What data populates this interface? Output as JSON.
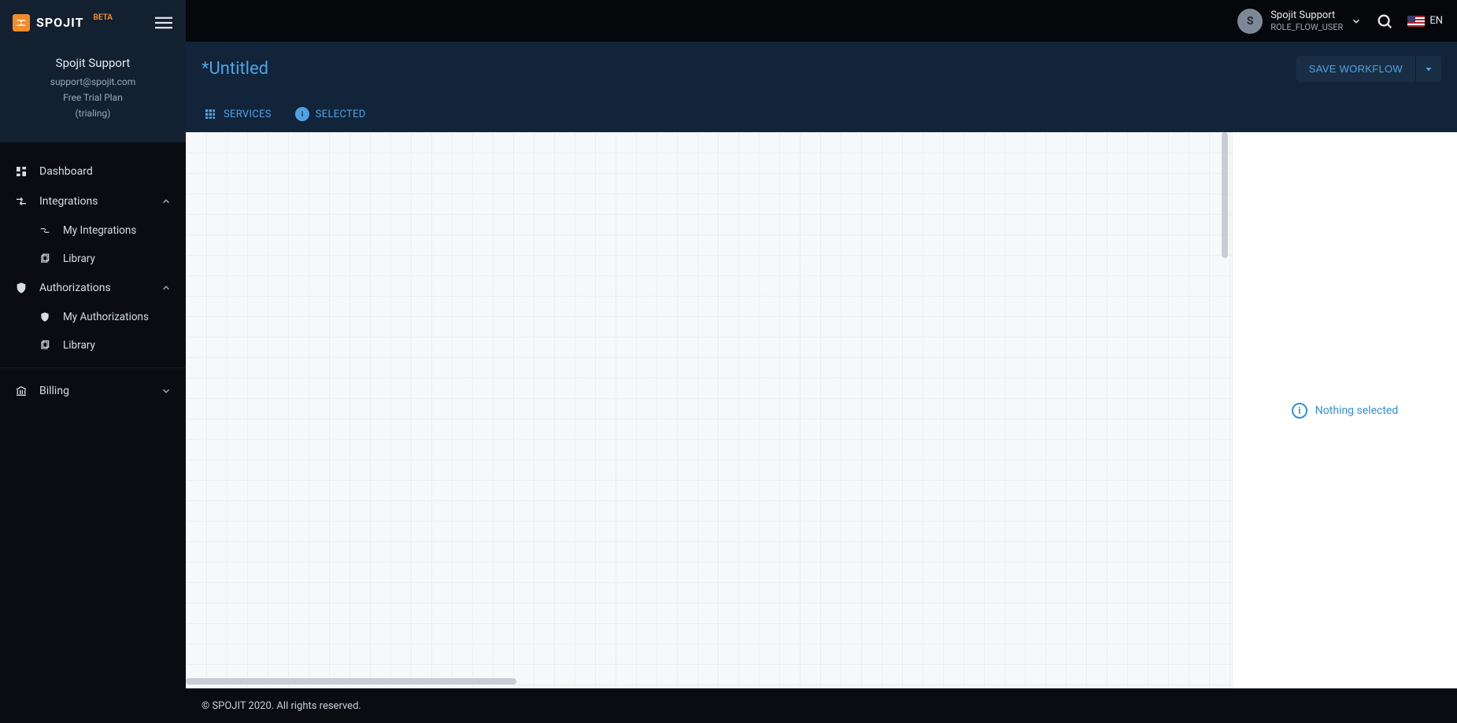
{
  "brand": {
    "name": "SPOJIT",
    "badge": "BETA"
  },
  "profile": {
    "name": "Spojit Support",
    "email": "support@spojit.com",
    "plan": "Free Trial Plan",
    "status": "(trialing)"
  },
  "sidebar": {
    "dashboard": "Dashboard",
    "integrations": {
      "label": "Integrations",
      "my": "My Integrations",
      "library": "Library"
    },
    "authorizations": {
      "label": "Authorizations",
      "my": "My Authorizations",
      "library": "Library"
    },
    "billing": {
      "label": "Billing"
    }
  },
  "topbar": {
    "user_name": "Spojit Support",
    "user_role": "ROLE_FLOW_USER",
    "avatar_initial": "S",
    "lang": "EN"
  },
  "page": {
    "title": "*Untitled",
    "save_label": "SAVE WORKFLOW"
  },
  "tabs": {
    "services": "SERVICES",
    "selected": "SELECTED"
  },
  "rightpanel": {
    "nothing": "Nothing selected"
  },
  "footer": {
    "copyright": "© SPOJIT 2020. All rights reserved."
  }
}
